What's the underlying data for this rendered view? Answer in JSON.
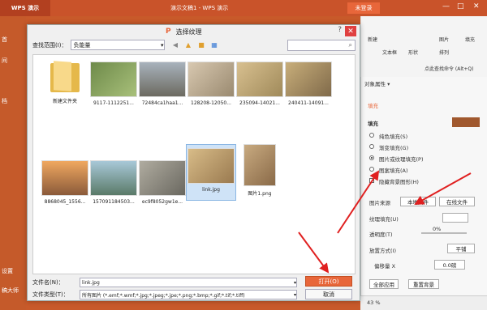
{
  "app": {
    "logo": "WPS 演示",
    "doc_title": "演示文稿1 - WPS 演示",
    "login": "未登录",
    "minimize": "—",
    "maximize": "□",
    "close": "✕"
  },
  "left_panel": [
    "首",
    "间",
    "档",
    "设置",
    "稿大师"
  ],
  "ribbon": {
    "new_slide": "新建",
    "textbox": "文本框",
    "shape": "形状",
    "arrange": "排列",
    "picture": "图片",
    "fill": "填充",
    "command_search": "点此查找命令 (Alt+Q)"
  },
  "dialog": {
    "title": "选择纹理",
    "help": "?",
    "close": "✕",
    "look_in_label": "查找范围(I)：",
    "look_in_value": "负能量",
    "search_placeholder": "",
    "files": [
      {
        "name": "新建文件夹",
        "kind": "folder"
      },
      {
        "name": "9117-1112251...",
        "kind": "image",
        "color": "#7f9a5c"
      },
      {
        "name": "72484ca1haa1...",
        "kind": "image",
        "color": "#8a8f95"
      },
      {
        "name": "128208-12050...",
        "kind": "image",
        "color": "#c7b49a"
      },
      {
        "name": "235094-14021...",
        "kind": "image",
        "color": "#c8b07c"
      },
      {
        "name": "240411-14091...",
        "kind": "image",
        "color": "#bca06e"
      },
      {
        "name": "8868045_1556...",
        "kind": "image",
        "color": "#d98a4a"
      },
      {
        "name": "157091184503...",
        "kind": "image",
        "color": "#7fa0a8"
      },
      {
        "name": "ec9f8052gw1e...",
        "kind": "image",
        "color": "#8f8f8a"
      },
      {
        "name": "link.jpg",
        "kind": "image",
        "color": "#c9a66b",
        "selected": true
      },
      {
        "name": "图片1.png",
        "kind": "image",
        "color": "#b99a6e"
      }
    ],
    "filename_label": "文件名(N)：",
    "filename_value": "link.jpg",
    "filetype_label": "文件类型(T)：",
    "filetype_value": "所有图片 (*.emf;*.wmf;*.jpg;*.jpeg;*.jpe;*.png;*.bmp;*.gif;*.tif;*.tiff)",
    "open_label": "打开(O)",
    "cancel_label": "取消"
  },
  "props": {
    "header": "对象属性 ▾",
    "fill_tab": "填充",
    "fill_section": "填充",
    "options": [
      {
        "label": "纯色填充(S)",
        "checked": false
      },
      {
        "label": "渐变填充(G)",
        "checked": false
      },
      {
        "label": "图片或纹理填充(P)",
        "checked": true
      },
      {
        "label": "图案填充(A)",
        "checked": false
      },
      {
        "label": "隐藏背景图形(H)",
        "checked": false
      }
    ],
    "source_label": "图片来源",
    "local_file": "本地文件",
    "online_file": "在线文件",
    "texture_label": "纹理填充(U)",
    "transparency_label": "透明度(T)",
    "transparency_value": "0%",
    "placement_label": "放置方式(I)",
    "placement_value": "平铺",
    "offset_x_label": "偏移量 X",
    "offset_x_value": "0.0磅",
    "apply_all": "全部应用",
    "reset": "重置背景",
    "zoom": "43 %",
    "swatch_color": "#a0582e"
  }
}
